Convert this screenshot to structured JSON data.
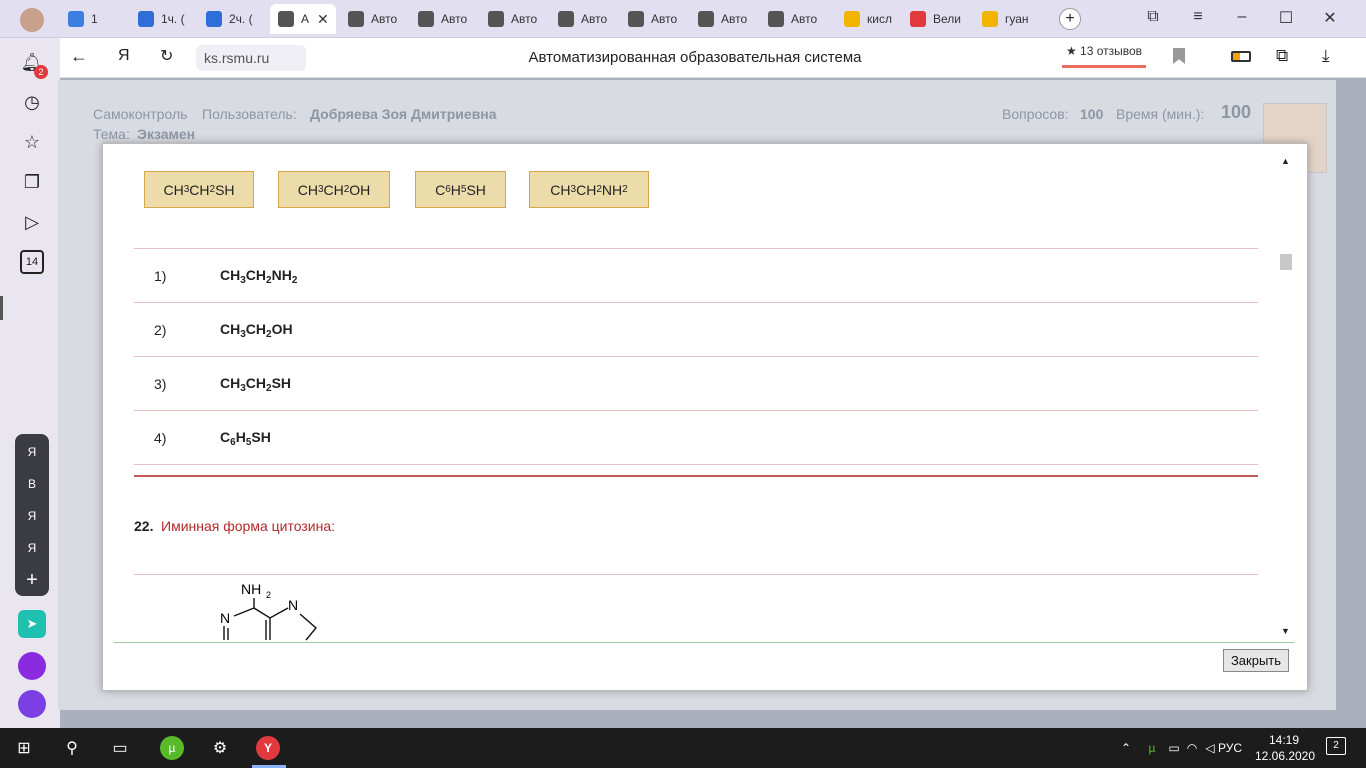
{
  "browser": {
    "tabs": [
      {
        "label": "1",
        "icon": "chat-icon",
        "color": "#3d7fe0"
      },
      {
        "label": "1ч. (",
        "icon": "doc-icon",
        "color": "#2f6ed8"
      },
      {
        "label": "2ч. (",
        "icon": "doc-icon",
        "color": "#2f6ed8"
      },
      {
        "label": "А",
        "icon": "page-icon",
        "color": "#555"
      },
      {
        "label": "Авто",
        "icon": "page-icon",
        "color": "#555"
      },
      {
        "label": "Авто",
        "icon": "page-icon",
        "color": "#555"
      },
      {
        "label": "Авто",
        "icon": "page-icon",
        "color": "#555"
      },
      {
        "label": "Авто",
        "icon": "page-icon",
        "color": "#555"
      },
      {
        "label": "Авто",
        "icon": "page-icon",
        "color": "#555"
      },
      {
        "label": "Авто",
        "icon": "page-icon",
        "color": "#555"
      },
      {
        "label": "Авто",
        "icon": "page-icon",
        "color": "#555"
      },
      {
        "label": "кисл",
        "icon": "image-icon",
        "color": "#f1b400"
      },
      {
        "label": "Вели",
        "icon": "yandex-icon",
        "color": "#e0393e"
      },
      {
        "label": "гуан",
        "icon": "image-icon",
        "color": "#f1b400"
      }
    ],
    "url": "ks.rsmu.ru",
    "page_title": "Автоматизированная образовательная система",
    "reviews": "★ 13 отзывов",
    "yandex_letter": "Я",
    "rail_badge": "2",
    "rail_calendar": "14",
    "rail_group": [
      "Я",
      "В",
      "Я",
      "Я"
    ]
  },
  "header": {
    "mode": "Самоконтроль",
    "user_label": "Пользователь:",
    "user_name": "Добряева Зоя Дмитриевна",
    "topic_label": "Тема:",
    "topic": "Экзамен",
    "questions_label": "Вопросов:",
    "questions": "100",
    "time_label": "Время (мин.):",
    "time": "100"
  },
  "modal": {
    "chips": [
      {
        "parts": [
          "CH",
          "3",
          "CH",
          "2",
          "SH"
        ]
      },
      {
        "parts": [
          "CH",
          "3",
          "CH",
          "2",
          "OH"
        ]
      },
      {
        "parts": [
          "C",
          "6",
          "H",
          "5",
          "SH"
        ]
      },
      {
        "parts": [
          "CH",
          "3",
          "CH",
          "2",
          "NH",
          "2",
          ""
        ]
      }
    ],
    "answers": [
      {
        "num": "1)",
        "parts": [
          "CH",
          "3",
          "CH",
          "2",
          "NH",
          "2",
          ""
        ]
      },
      {
        "num": "2)",
        "parts": [
          "CH",
          "3",
          "CH",
          "2",
          "OH"
        ]
      },
      {
        "num": "3)",
        "parts": [
          "CH",
          "3",
          "CH",
          "2",
          "SH"
        ]
      },
      {
        "num": "4)",
        "parts": [
          "C",
          "6",
          "H",
          "5",
          "SH"
        ]
      }
    ],
    "q_number": "22.",
    "q_text": "Иминная форма цитозина:",
    "structure_nh": "NH",
    "structure_sub": "2",
    "structure_n": "N",
    "close": "Закрыть"
  },
  "taskbar": {
    "time": "14:19",
    "date": "12.06.2020",
    "lang": "РУС",
    "notif": "2"
  }
}
